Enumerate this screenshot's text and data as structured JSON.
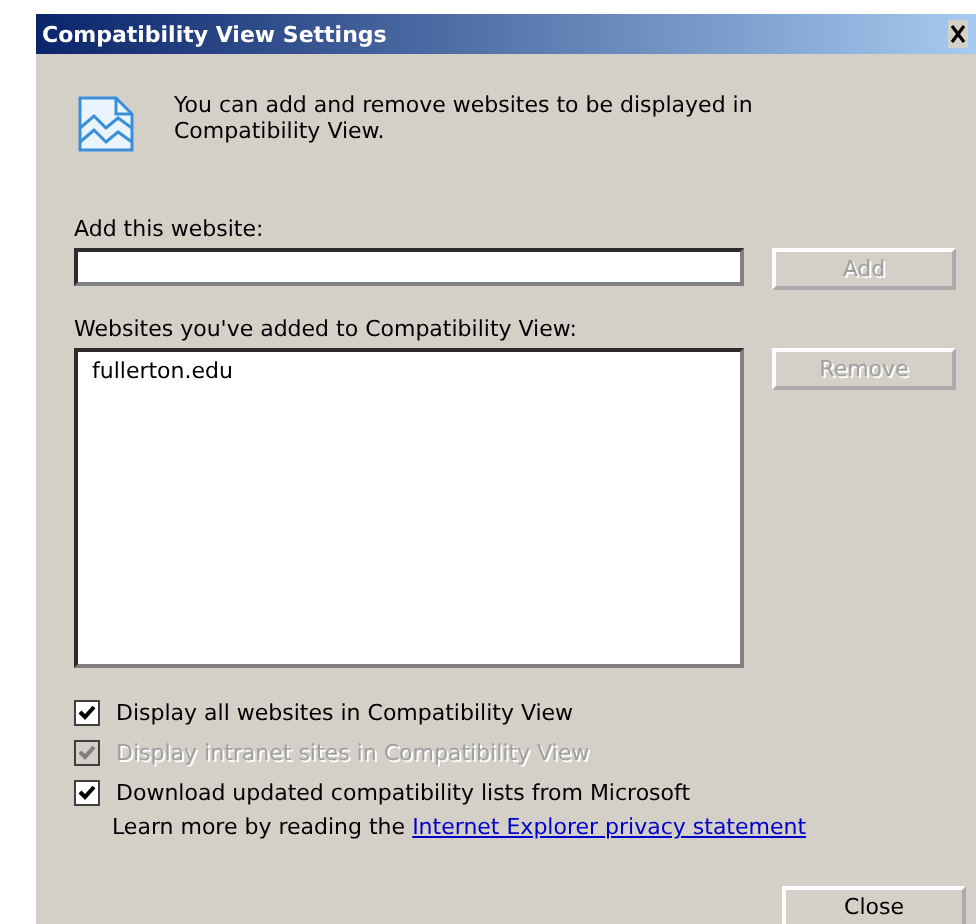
{
  "window": {
    "title": "Compatibility View Settings"
  },
  "intro": "You can add and remove websites to be displayed in Compatibility View.",
  "add_field": {
    "label": "Add this website:"
  },
  "add_button": {
    "label": "Add",
    "disabled": true
  },
  "site_list": {
    "label": "Websites you've added to Compatibility View:",
    "items": [
      {
        "text": "fullerton.edu",
        "selected": false
      }
    ]
  },
  "remove_button": {
    "label": "Remove",
    "disabled": true
  },
  "options": [
    {
      "label": "Display all websites in Compatibility View",
      "checked": true,
      "disabled": false
    },
    {
      "label": "Display intranet sites in Compatibility View",
      "checked": true,
      "disabled": true
    },
    {
      "label": "Download updated compatibility lists from Microsoft",
      "checked": true,
      "disabled": false
    }
  ],
  "privacy": {
    "text": "Learn more by reading the",
    "link": "Internet Explorer privacy statement"
  },
  "buttons": [
    "Close"
  ]
}
